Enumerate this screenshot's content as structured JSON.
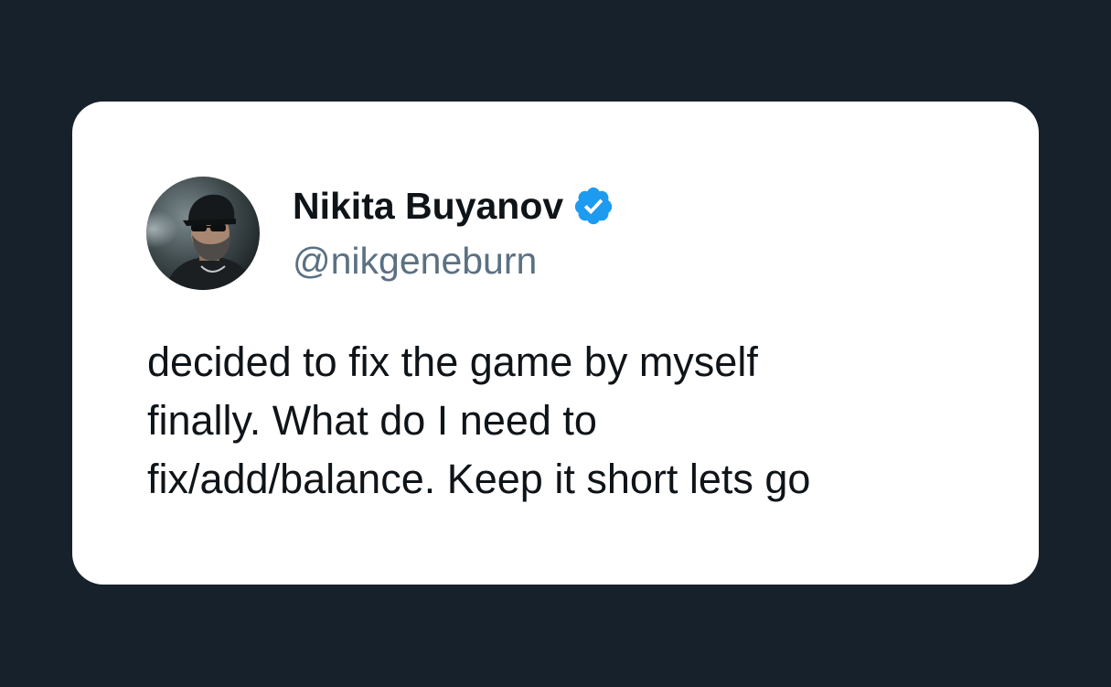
{
  "colors": {
    "page_background": "#17212b",
    "card_background": "#ffffff",
    "name_color": "#0f1419",
    "handle_color": "#5b7083",
    "verified_badge": "#1d9bf0"
  },
  "author": {
    "display_name": "Nikita Buyanov",
    "handle": "@nikgeneburn",
    "verified": true,
    "avatar_icon": "avatar-photo",
    "badge_icon": "verified-badge-icon"
  },
  "tweet": {
    "lines": [
      "decided to fix the game by myself",
      "finally. What do I need to",
      "fix/add/balance. Keep it short lets go"
    ]
  }
}
